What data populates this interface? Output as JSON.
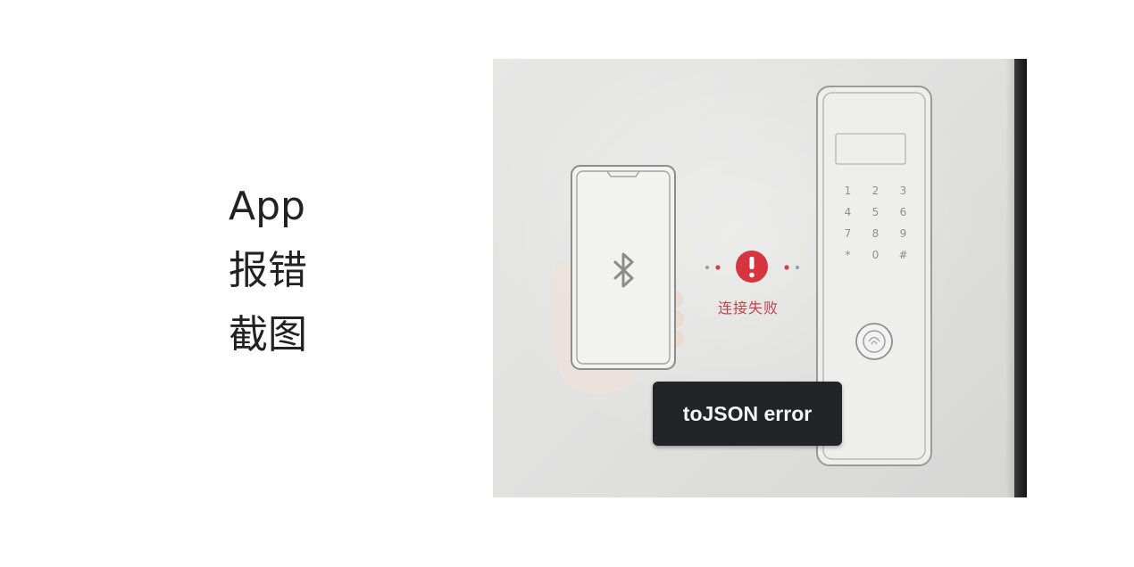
{
  "caption": {
    "line1": "App",
    "line2": "报错",
    "line3": "截图"
  },
  "screen": {
    "connection_status": "连接失败",
    "toast_message": "toJSON error",
    "keypad_keys": [
      "1",
      "2",
      "3",
      "4",
      "5",
      "6",
      "7",
      "8",
      "9",
      "*",
      "0",
      "#"
    ]
  },
  "icons": {
    "phone_icon": "bluetooth-icon",
    "status_icon": "alert-icon",
    "lock_sensor": "fingerprint-icon"
  },
  "colors": {
    "alert": "#d6343e",
    "fail_text": "#c0454b",
    "toast_bg": "#222428",
    "toast_text": "#f4f4f4"
  }
}
